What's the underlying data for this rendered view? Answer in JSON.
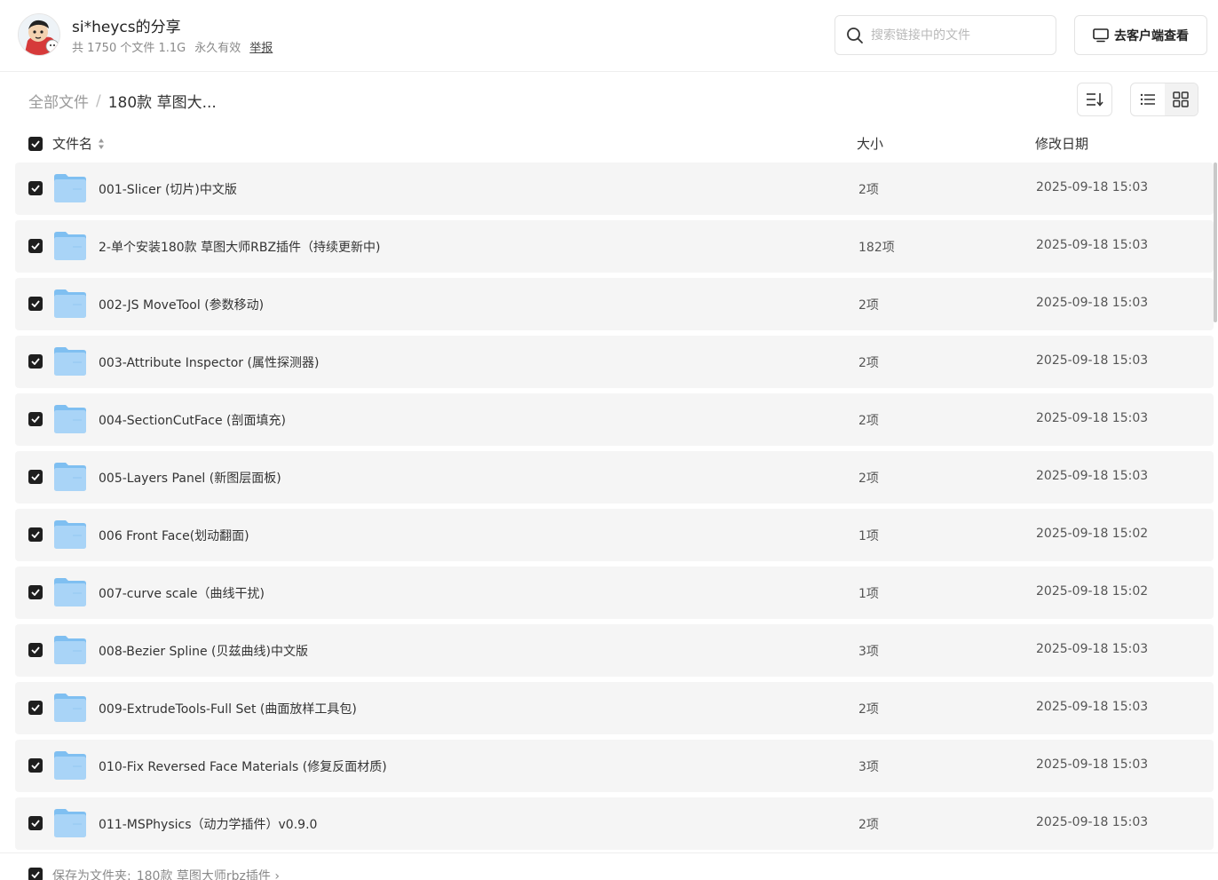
{
  "header": {
    "share_title": "si*heycs的分享",
    "file_count": "共 1750 个文件 1.1G",
    "validity": "永久有效",
    "report_label": "举报",
    "search_placeholder": "搜索链接中的文件",
    "client_button_label": "去客户端查看"
  },
  "breadcrumb": {
    "root": "全部文件",
    "separator": "/",
    "current": "180款 草图大..."
  },
  "table": {
    "col_name": "文件名",
    "col_size": "大小",
    "col_date": "修改日期",
    "rows": [
      {
        "name": "001-Slicer (切片)中文版",
        "size": "2项",
        "date": "2025-09-18 15:03"
      },
      {
        "name": "2-单个安装180款 草图大师RBZ插件（持续更新中)",
        "size": "182项",
        "date": "2025-09-18 15:03"
      },
      {
        "name": "002-JS MoveTool (参数移动)",
        "size": "2项",
        "date": "2025-09-18 15:03"
      },
      {
        "name": "003-Attribute Inspector (属性探测器)",
        "size": "2项",
        "date": "2025-09-18 15:03"
      },
      {
        "name": "004-SectionCutFace (剖面填充)",
        "size": "2项",
        "date": "2025-09-18 15:03"
      },
      {
        "name": "005-Layers Panel (新图层面板)",
        "size": "2项",
        "date": "2025-09-18 15:03"
      },
      {
        "name": "006 Front Face(划动翻面)",
        "size": "1项",
        "date": "2025-09-18 15:02"
      },
      {
        "name": "007-curve scale（曲线干扰)",
        "size": "1项",
        "date": "2025-09-18 15:02"
      },
      {
        "name": "008-Bezier Spline (贝兹曲线)中文版",
        "size": "3项",
        "date": "2025-09-18 15:03"
      },
      {
        "name": "009-ExtrudeTools-Full Set (曲面放样工具包)",
        "size": "2项",
        "date": "2025-09-18 15:03"
      },
      {
        "name": "010-Fix Reversed Face Materials (修复反面材质)",
        "size": "3项",
        "date": "2025-09-18 15:03"
      },
      {
        "name": "011-MSPhysics（动力学插件）v0.9.0",
        "size": "2项",
        "date": "2025-09-18 15:03"
      }
    ]
  },
  "footer": {
    "save_label": "保存为文件夹:",
    "save_path": "180款 草图大师rbz插件 ›"
  },
  "colors": {
    "checkbox": "#1f1f1f",
    "row_bg": "#f5f5f5",
    "folder_light": "#a9d4f7",
    "folder_dark": "#7fbff1"
  }
}
